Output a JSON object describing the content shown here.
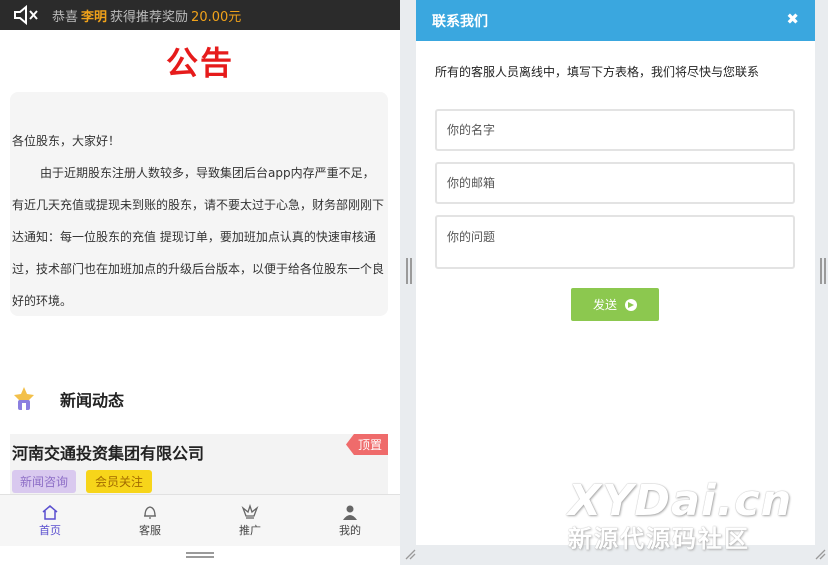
{
  "notice": {
    "prefix": "恭喜",
    "name": "李明",
    "middle": "获得推荐奖励",
    "amount": "20.00元"
  },
  "page_title": "公告",
  "announcement": {
    "greeting": "各位股东，大家好！",
    "body": "由于近期股东注册人数较多，导致集团后台app内存严重不足，有近几天充值或提现未到账的股东，请不要太过于心急，财务部刚刚下达通知：每一位股东的充值 提现订单，要加班加点认真的快速审核通过，技术部门也在加班加点的升级后台版本，以便于给各位股东一个良好的环境。"
  },
  "news": {
    "heading": "新闻动态",
    "item": {
      "title": "河南交通投资集团有限公司",
      "pin_label": "顶置",
      "tags": [
        "新闻咨询",
        "会员关注"
      ]
    }
  },
  "tabbar": {
    "items": [
      {
        "label": "首页",
        "icon": "home-icon",
        "active": true
      },
      {
        "label": "客服",
        "icon": "bell-icon"
      },
      {
        "label": "推广",
        "icon": "crown-icon"
      },
      {
        "label": "我的",
        "icon": "user-icon"
      }
    ]
  },
  "contact": {
    "title": "联系我们",
    "close_glyph": "✖",
    "description": "所有的客服人员离线中，填写下方表格，我们将尽快与您联系",
    "name_placeholder": "你的名字",
    "email_placeholder": "你的邮箱",
    "question_placeholder": "你的问题",
    "send_label": "发送"
  },
  "watermark": {
    "line1": "XYDai.cn",
    "line2": "新源代源码社区"
  },
  "colors": {
    "title_red": "#e61b1b",
    "header_blue": "#3aa7df",
    "send_green": "#8cc84f",
    "active_tab": "#5a4fcf",
    "highlight_orange": "#f0a21a"
  }
}
